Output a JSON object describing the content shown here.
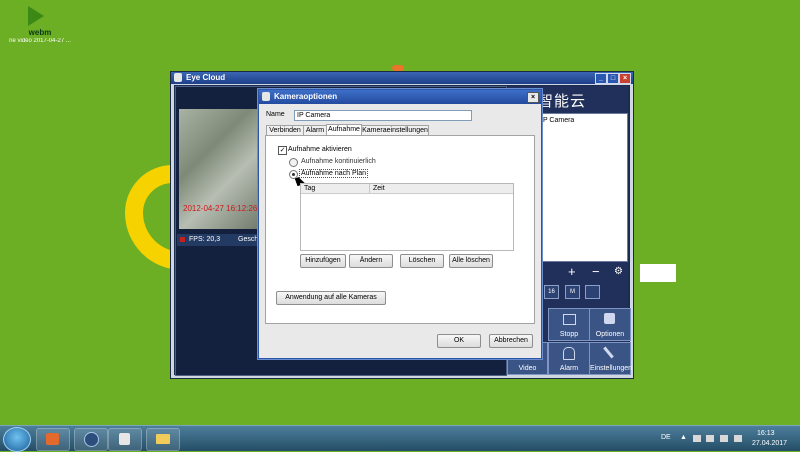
{
  "desktop": {
    "icon_name": "webm",
    "icon_file": "ne video 2017-04-27 ..."
  },
  "eyecloud": {
    "title": "Eye Cloud",
    "video_timestamp": "2012-04-27 16:12:26",
    "fps_label": "FPS: 20,3",
    "speed_label": "Geschw",
    "brand_text": "智能云",
    "camera_item": "IP Camera",
    "buttons": {
      "stopp": "Stopp",
      "optionen": "Optionen",
      "video": "Video",
      "alarm": "Alarm",
      "einstellungen": "Einstellungen"
    },
    "controls": {
      "add": "+",
      "remove": "−",
      "settings": "⚙"
    },
    "grid_labels": [
      "",
      "",
      "16",
      "M",
      ""
    ]
  },
  "dialog": {
    "title": "Kameraoptionen",
    "name_label": "Name",
    "name_value": "IP Camera",
    "tabs": [
      "Verbinden",
      "Alarm",
      "Aufnahme",
      "Kameraeinstellungen"
    ],
    "active_tab": "Aufnahme",
    "enable_recording": "Aufnahme aktivieren",
    "option_continuous": "Aufnahme kontinuierlich",
    "option_schedule": "Aufnahme nach Plan",
    "table_headers": [
      "Tag",
      "Zeit"
    ],
    "buttons": {
      "add": "Hinzufügen",
      "edit": "Ändern",
      "delete": "Löschen",
      "delete_all": "Alle löschen",
      "apply_all": "Anwendung auf alle Kameras",
      "ok": "OK",
      "cancel": "Abbrechen"
    }
  },
  "taskbar": {
    "language": "DE",
    "time": "16:13",
    "date": "27.04.2017"
  },
  "colors": {
    "desktop_bg": "#6cae24",
    "logo_yellow": "#f6d200",
    "title_blue": "#234b9e",
    "app_dark": "#1c2c4f"
  }
}
